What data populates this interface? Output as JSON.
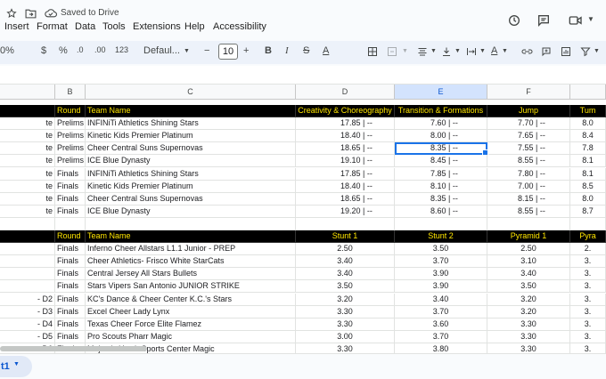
{
  "header": {
    "saved_status": "Saved to Drive"
  },
  "menu": [
    "Insert",
    "Format",
    "Data",
    "Tools",
    "Extensions",
    "Help",
    "Accessibility"
  ],
  "toolbar": {
    "zoom": "0%",
    "currency": "$",
    "percent": "%",
    "dec_decrease": ".0",
    "dec_increase": ".00",
    "number_format": "123",
    "font": "Defaul...",
    "minus": "−",
    "font_size": "10",
    "plus": "+"
  },
  "columns": [
    {
      "label": "",
      "w": 62
    },
    {
      "label": "B",
      "w": 34
    },
    {
      "label": "C",
      "w": 236
    },
    {
      "label": "D",
      "w": 111
    },
    {
      "label": "E",
      "w": 104
    },
    {
      "label": "F",
      "w": 93
    },
    {
      "label": "",
      "w": 40
    }
  ],
  "rows": [
    {
      "dark": true,
      "cells": [
        "",
        "Round",
        "Team Name",
        "Creativity  & Choreography",
        "Transition  & Formations",
        "Jump",
        "Tum"
      ]
    },
    {
      "cells": [
        "te",
        "Prelims",
        "INFINiTi Athletics Shining Stars",
        "17.85 | --",
        "7.60 | --",
        "7.70 | --",
        "8.0"
      ]
    },
    {
      "cells": [
        "te",
        "Prelims",
        "Kinetic Kids Premier Platinum",
        "18.40 | --",
        "8.00 | --",
        "7.65 | --",
        "8.4"
      ]
    },
    {
      "cells": [
        "te",
        "Prelims",
        "Cheer Central Suns Supernovas",
        "18.65 | --",
        "8.35 | --",
        "7.55 | --",
        "7.8"
      ]
    },
    {
      "cells": [
        "te",
        "Prelims",
        "ICE Blue Dynasty",
        "19.10 | --",
        "8.45 | --",
        "8.55 | --",
        "8.1"
      ]
    },
    {
      "cells": [
        "te",
        "Finals",
        "INFINiTi Athletics Shining Stars",
        "17.85 | --",
        "7.85 | --",
        "7.80 | --",
        "8.1"
      ]
    },
    {
      "cells": [
        "te",
        "Finals",
        "Kinetic Kids Premier Platinum",
        "18.40 | --",
        "8.10 | --",
        "7.00 | --",
        "8.5"
      ]
    },
    {
      "cells": [
        "te",
        "Finals",
        "Cheer Central Suns Supernovas",
        "18.65 | --",
        "8.35 | --",
        "8.15 | --",
        "8.0"
      ]
    },
    {
      "cells": [
        "te",
        "Finals",
        "ICE Blue Dynasty",
        "19.20 | --",
        "8.60 | --",
        "8.55 | --",
        "8.7"
      ]
    },
    {
      "blank": true,
      "cells": [
        "",
        "",
        "",
        "",
        "",
        "",
        ""
      ]
    },
    {
      "dark": true,
      "cells": [
        "",
        "Round",
        "Team Name",
        "Stunt 1",
        "Stunt 2",
        "Pyramid 1",
        "Pyra"
      ]
    },
    {
      "cells": [
        "",
        "Finals",
        "Inferno Cheer Allstars L1.1 Junior - PREP",
        "2.50",
        "3.50",
        "2.50",
        "2."
      ]
    },
    {
      "cells": [
        "",
        "Finals",
        "Cheer Athletics- Frisco White StarCats",
        "3.40",
        "3.70",
        "3.10",
        "3."
      ]
    },
    {
      "cells": [
        "",
        "Finals",
        "Central Jersey All Stars Bullets",
        "3.40",
        "3.90",
        "3.40",
        "3."
      ]
    },
    {
      "cells": [
        "",
        "Finals",
        "Stars Vipers San Antonio JUNIOR STRIKE",
        "3.50",
        "3.90",
        "3.50",
        "3."
      ]
    },
    {
      "cells": [
        "- D2",
        "Finals",
        "KC's Dance & Cheer Center K.C.'s Stars",
        "3.20",
        "3.40",
        "3.20",
        "3."
      ]
    },
    {
      "cells": [
        "- D3",
        "Finals",
        "Excel Cheer Lady Lynx",
        "3.30",
        "3.70",
        "3.20",
        "3."
      ]
    },
    {
      "cells": [
        "- D4",
        "Finals",
        "Texas Cheer Force Elite Flamez",
        "3.30",
        "3.60",
        "3.30",
        "3."
      ]
    },
    {
      "cells": [
        "- D5",
        "Finals",
        "Pro Scouts Pharr Magic",
        "3.00",
        "3.70",
        "3.30",
        "3."
      ]
    },
    {
      "cells": [
        "- D6",
        "Finals",
        "Majestic Youth Sports Center Magic",
        "3.30",
        "3.80",
        "3.30",
        "3."
      ]
    }
  ],
  "selected_cell": {
    "row": 3,
    "col": 4
  },
  "sheet_tab": "t1"
}
